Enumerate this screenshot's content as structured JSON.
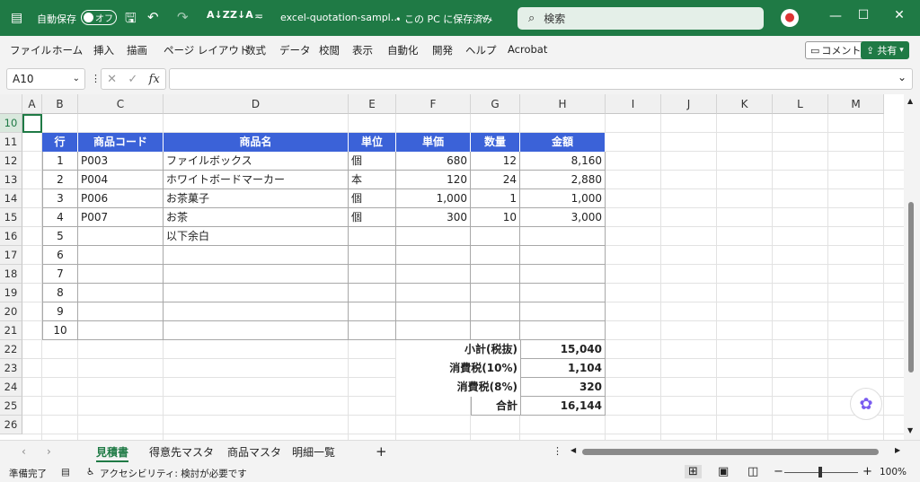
{
  "titlebar": {
    "autosave_label": "自動保存",
    "autosave_toggle": "オフ",
    "filename": "excel-quotation-sampl…",
    "save_location": "• この PC に保存済み",
    "search_placeholder": "検索"
  },
  "menu": [
    "ファイル",
    "ホーム",
    "挿入",
    "描画",
    "ページ レイアウト",
    "数式",
    "データ",
    "校閲",
    "表示",
    "自動化",
    "開発",
    "ヘルプ",
    "Acrobat"
  ],
  "ribbon_buttons": {
    "comment": "コメント",
    "share": "共有"
  },
  "formula": {
    "name_box": "A10",
    "fx": "fx",
    "value": ""
  },
  "columns": [
    "A",
    "B",
    "C",
    "D",
    "E",
    "F",
    "G",
    "H",
    "I",
    "J",
    "K",
    "L",
    "M"
  ],
  "rows": [
    "10",
    "11",
    "12",
    "13",
    "14",
    "15",
    "16",
    "17",
    "18",
    "19",
    "20",
    "21",
    "22",
    "23",
    "24",
    "25",
    "26"
  ],
  "table": {
    "headers": [
      "行",
      "商品コード",
      "商品名",
      "単位",
      "単価",
      "数量",
      "金額"
    ],
    "items": [
      [
        "1",
        "P003",
        "ファイルボックス",
        "個",
        "680",
        "12",
        "8,160"
      ],
      [
        "2",
        "P004",
        "ホワイトボードマーカー",
        "本",
        "120",
        "24",
        "2,880"
      ],
      [
        "3",
        "P006",
        "お茶菓子",
        "個",
        "1,000",
        "1",
        "1,000"
      ],
      [
        "4",
        "P007",
        "お茶",
        "個",
        "300",
        "10",
        "3,000"
      ],
      [
        "5",
        "",
        "以下余白",
        "",
        "",
        "",
        ""
      ],
      [
        "6",
        "",
        "",
        "",
        "",
        "",
        ""
      ],
      [
        "7",
        "",
        "",
        "",
        "",
        "",
        ""
      ],
      [
        "8",
        "",
        "",
        "",
        "",
        "",
        ""
      ],
      [
        "9",
        "",
        "",
        "",
        "",
        "",
        ""
      ],
      [
        "10",
        "",
        "",
        "",
        "",
        "",
        ""
      ]
    ],
    "totals": [
      {
        "label": "小計(税抜)",
        "value": "15,040"
      },
      {
        "label": "消費税(10%)",
        "value": "1,104"
      },
      {
        "label": "消費税(8%)",
        "value": "320"
      },
      {
        "label": "合計",
        "value": "16,144"
      }
    ]
  },
  "sheets": [
    "見積書",
    "得意先マスタ",
    "商品マスタ",
    "明細一覧"
  ],
  "status": {
    "ready": "準備完了",
    "accessibility": "アクセシビリティ: 検討が必要です",
    "zoom": "100%"
  },
  "colors": {
    "title_green": "#1f7a45",
    "header_blue": "#3b62d8"
  }
}
